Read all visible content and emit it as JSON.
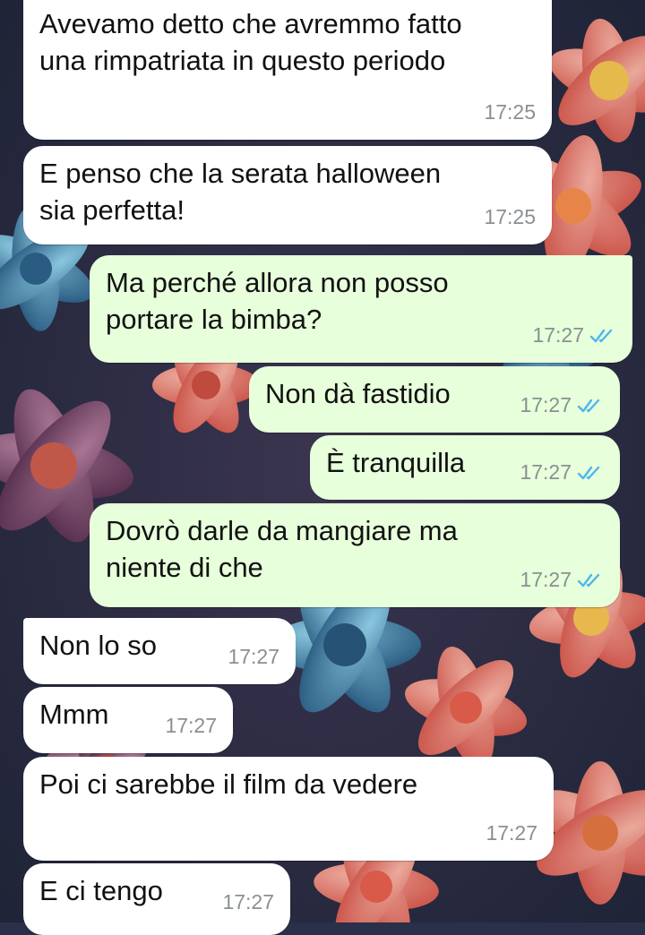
{
  "messages": [
    {
      "direction": "in",
      "text": "Avevamo detto che avremmo fatto\nuna rimpatriata in questo periodo",
      "time": "17:25"
    },
    {
      "direction": "in",
      "text": "E penso che la serata halloween\nsia perfetta!",
      "time": "17:25"
    },
    {
      "direction": "out",
      "text": "Ma perché allora non posso\nportare la bimba?",
      "time": "17:27",
      "status": "read"
    },
    {
      "direction": "out",
      "text": "Non dà fastidio",
      "time": "17:27",
      "status": "read"
    },
    {
      "direction": "out",
      "text": "È tranquilla",
      "time": "17:27",
      "status": "read"
    },
    {
      "direction": "out",
      "text": "Dovrò darle da mangiare ma\nniente di che",
      "time": "17:27",
      "status": "read"
    },
    {
      "direction": "in",
      "text": "Non lo so",
      "time": "17:27"
    },
    {
      "direction": "in",
      "text": "Mmm",
      "time": "17:27"
    },
    {
      "direction": "in",
      "text": "Poi ci sarebbe il film da vedere",
      "time": "17:27"
    },
    {
      "direction": "in",
      "text": "E ci tengo",
      "time": "17:27"
    }
  ],
  "colors": {
    "incoming_bubble": "#ffffff",
    "outgoing_bubble": "#e7ffdb",
    "read_ticks": "#4fb6ec",
    "timestamp": "#8a8f92"
  },
  "icons": {
    "read_receipt": "double-check-icon"
  }
}
